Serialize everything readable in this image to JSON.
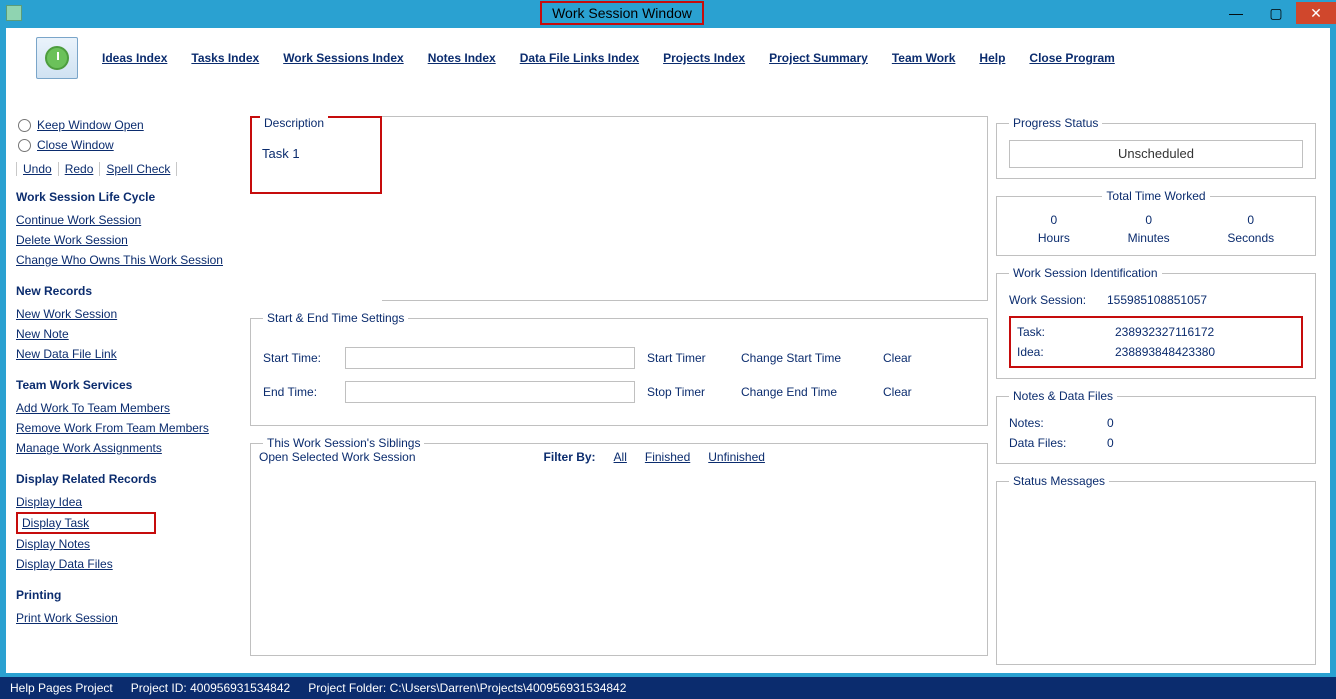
{
  "window": {
    "title": "Work Session Window",
    "controls": {
      "min": "—",
      "max": "▢",
      "close": "✕"
    }
  },
  "toolbar": {
    "ideas": "Ideas Index",
    "tasks": "Tasks Index",
    "worksessions": "Work Sessions Index",
    "notes": "Notes Index",
    "datafiles": "Data File Links Index",
    "projects": "Projects Index",
    "summary": "Project Summary",
    "team": "Team Work",
    "help": "Help",
    "close": "Close Program"
  },
  "sidebar": {
    "keep_open": "Keep Window Open",
    "close_win": "Close Window",
    "undo": "Undo",
    "redo": "Redo",
    "spell": "Spell Check",
    "sections": {
      "lifecycle": {
        "head": "Work Session Life Cycle",
        "continue": "Continue Work Session",
        "delete": "Delete Work Session",
        "change_owner": "Change Who Owns This Work Session"
      },
      "newrec": {
        "head": "New Records",
        "new_ws": "New Work Session",
        "new_note": "New Note",
        "new_dfl": "New Data File Link"
      },
      "team": {
        "head": "Team Work Services",
        "add": "Add Work To Team Members",
        "remove": "Remove Work From Team Members",
        "manage": "Manage Work Assignments"
      },
      "display": {
        "head": "Display Related Records",
        "idea": "Display Idea",
        "task": "Display Task",
        "notes": "Display Notes",
        "dfiles": "Display Data Files"
      },
      "printing": {
        "head": "Printing",
        "print": "Print Work Session"
      }
    }
  },
  "center": {
    "desc_label": "Description",
    "desc_value": "Task 1",
    "time": {
      "legend": "Start & End Time Settings",
      "start_lbl": "Start Time:",
      "end_lbl": "End Time:",
      "start_val": "",
      "end_val": "",
      "start_timer": "Start Timer",
      "stop_timer": "Stop Timer",
      "change_start": "Change Start Time",
      "change_end": "Change End Time",
      "clear": "Clear"
    },
    "siblings": {
      "legend": "This Work Session's Siblings",
      "open": "Open Selected Work Session",
      "filter_by": "Filter By:",
      "all": "All",
      "finished": "Finished",
      "unfinished": "Unfinished"
    }
  },
  "right": {
    "progress": {
      "legend": "Progress Status",
      "value": "Unscheduled"
    },
    "ttw": {
      "legend": "Total Time Worked",
      "h": "0",
      "m": "0",
      "s": "0",
      "hl": "Hours",
      "ml": "Minutes",
      "sl": "Seconds"
    },
    "ident": {
      "legend": "Work Session Identification",
      "ws_lbl": "Work Session:",
      "ws_val": "155985108851057",
      "task_lbl": "Task:",
      "task_val": "238932327116172",
      "idea_lbl": "Idea:",
      "idea_val": "238893848423380"
    },
    "notes": {
      "legend": "Notes & Data Files",
      "notes_lbl": "Notes:",
      "notes_val": "0",
      "df_lbl": "Data Files:",
      "df_val": "0"
    },
    "status_msgs": {
      "legend": "Status Messages"
    }
  },
  "statusbar": {
    "help": "Help Pages Project",
    "pid_lbl": "Project ID:",
    "pid": "400956931534842",
    "pf_lbl": "Project Folder:",
    "pf": "C:\\Users\\Darren\\Projects\\400956931534842"
  }
}
